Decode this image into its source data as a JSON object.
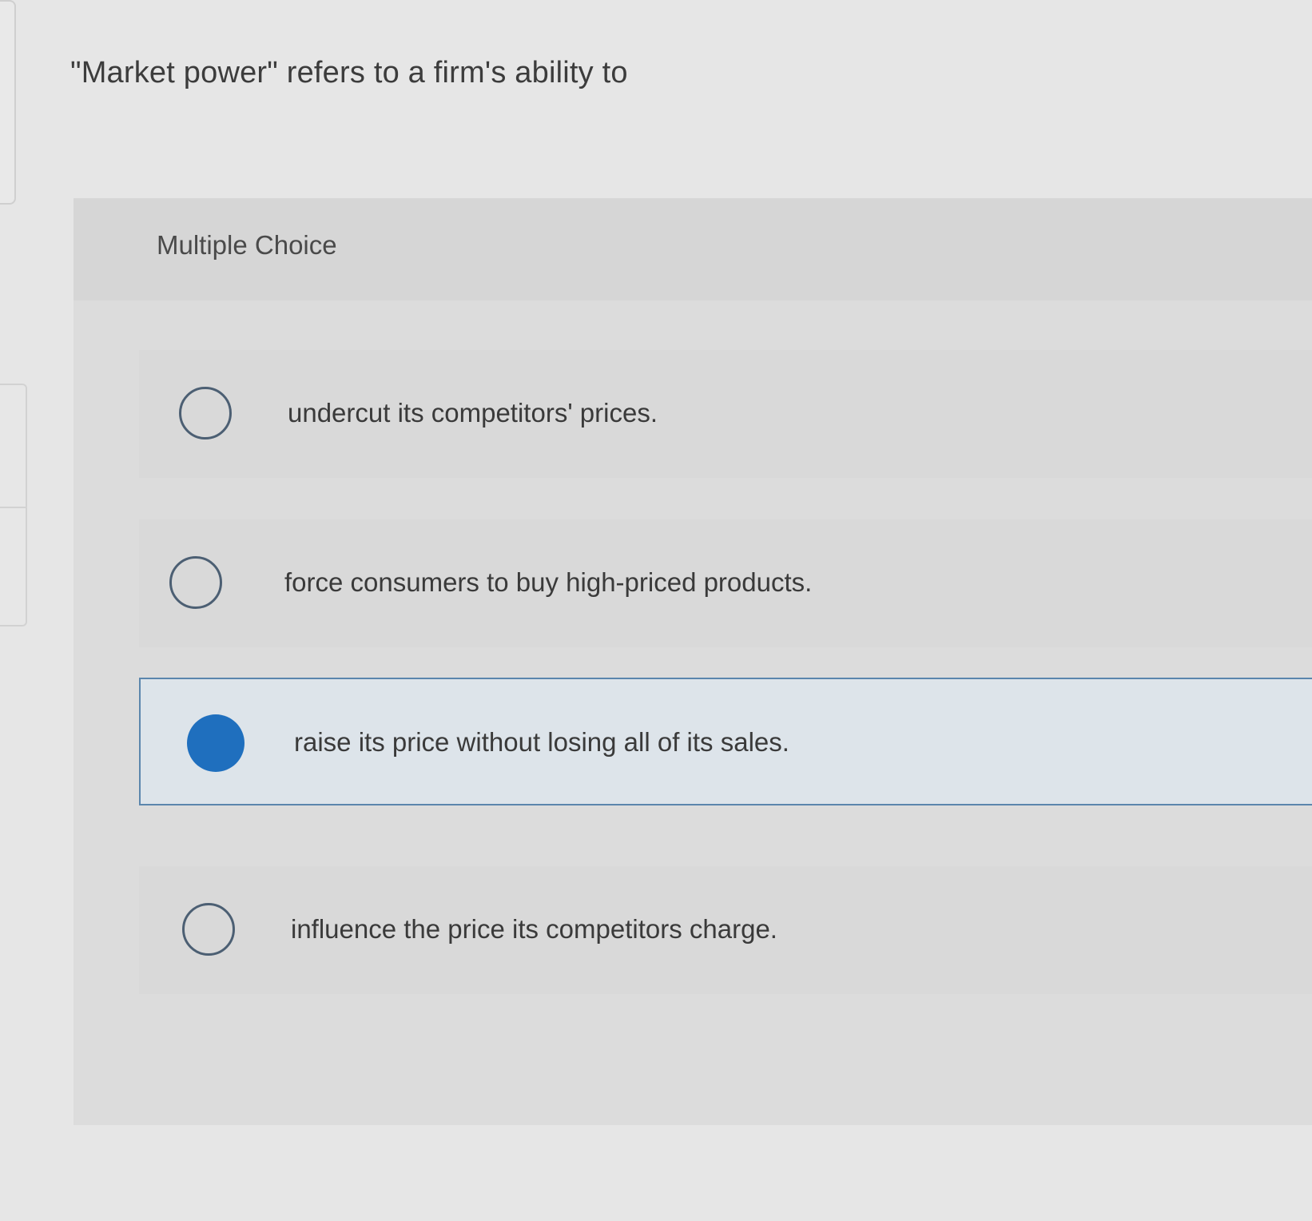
{
  "question": {
    "text": "\"Market power\" refers to a firm's ability to"
  },
  "multiple_choice": {
    "label": "Multiple Choice",
    "options": [
      {
        "text": "undercut its competitors' prices.",
        "selected": false
      },
      {
        "text": "force consumers to buy high-priced products.",
        "selected": false
      },
      {
        "text": "raise its price without losing all of its sales.",
        "selected": true
      },
      {
        "text": "influence the price its competitors charge.",
        "selected": false
      }
    ]
  },
  "colors": {
    "selected_radio": "#1f6fbe",
    "selected_border": "#5b86ad",
    "selected_background": "#dde4ea",
    "page_background": "#e6e6e6",
    "panel_background": "#dcdcdc"
  },
  "icons": {
    "radio_unselected": "radio-empty-icon",
    "radio_selected": "radio-filled-icon"
  }
}
